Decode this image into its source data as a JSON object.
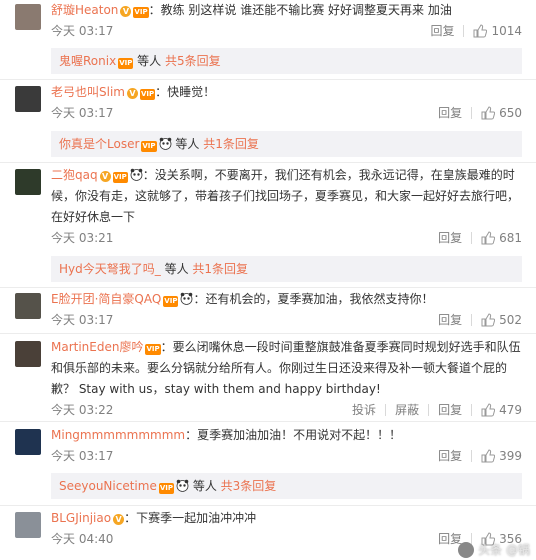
{
  "comments": [
    {
      "user": "舒璇Heaton",
      "text": "：教练 别这样说 谁还能不输比赛 好好调整夏天再来  加油",
      "time": "今天 03:17",
      "reply_label": "回复",
      "likes": "1014",
      "sub": {
        "user": "鬼喔Ronix",
        "others": "等人",
        "count": "共5条回复"
      }
    },
    {
      "user": "老弓也叫Slim",
      "text": "：快睡觉！",
      "time": "今天 03:17",
      "reply_label": "回复",
      "likes": "650",
      "sub": {
        "user": "你真是个Loser",
        "others": "等人",
        "count": "共1条回复"
      }
    },
    {
      "user": "二狍qaq",
      "text": "：没关系啊，不要离开，我们还有机会，我永远记得，在皇族最难的时候，你没有走，这就够了，带着孩子们找回场子，夏季赛见，和大家一起好好去旅行吧，在好好休息一下",
      "time": "今天 03:21",
      "reply_label": "回复",
      "likes": "681",
      "sub": {
        "user": "Hyd今天弩我了吗_",
        "others": "等人",
        "count": "共1条回复"
      }
    },
    {
      "user": "E脸开团·简自豪QAQ",
      "text": "：还有机会的，夏季赛加油，我依然支持你！",
      "time": "今天 03:17",
      "reply_label": "回复",
      "likes": "502"
    },
    {
      "user": "MartinEden廖吟",
      "text": "：要么闭嘴休息一段时间重整旗鼓准备夏季赛同时规划好选手和队伍和俱乐部的未来。要么分锅就分给所有人。你刚过生日还没来得及补一顿大餐道个屁的歉？ Stay with us，stay with them and happy birthday!",
      "time": "今天 03:22",
      "report_label": "投诉",
      "block_label": "屏蔽",
      "reply_label": "回复",
      "likes": "479"
    },
    {
      "user": "Mingmmmmmmmmm",
      "text": "：夏季赛加油加油！不用说对不起！！！",
      "time": "今天 03:17",
      "reply_label": "回复",
      "likes": "399",
      "sub": {
        "user": "SeeyouNicetime",
        "others": "等人",
        "count": "共3条回复"
      }
    },
    {
      "user": "BLGJinjiao",
      "text": "：下赛季一起加油冲冲冲",
      "time": "今天 04:40",
      "reply_label": "回复",
      "likes": "356"
    }
  ],
  "watermark": "头条 @锅",
  "colors": {
    "username": "#eb7350",
    "meta": "#808080",
    "reply_bg": "#f2f2f5",
    "vip_badge": "#f6a623"
  }
}
